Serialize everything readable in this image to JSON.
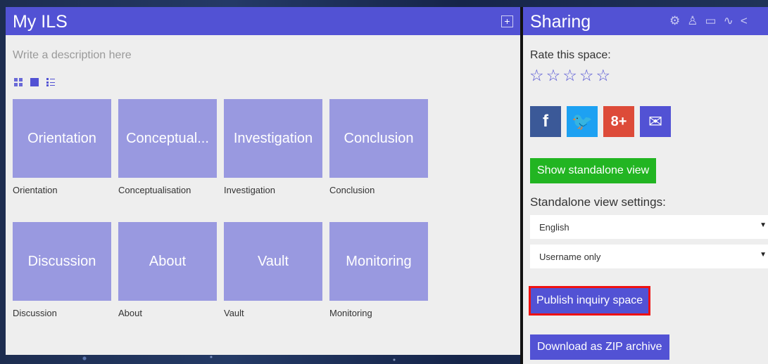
{
  "left_panel": {
    "title": "My ILS",
    "add_icon": "plus-square-icon",
    "description_placeholder": "Write a description here",
    "view_toggles": [
      "grid-view-icon",
      "tile-view-icon",
      "list-view-icon"
    ],
    "tiles": [
      {
        "label": "Orientation",
        "caption": "Orientation"
      },
      {
        "label": "Conceptual...",
        "caption": "Conceptualisation"
      },
      {
        "label": "Investigation",
        "caption": "Investigation"
      },
      {
        "label": "Conclusion",
        "caption": "Conclusion"
      },
      {
        "label": "Discussion",
        "caption": "Discussion"
      },
      {
        "label": "About",
        "caption": "About"
      },
      {
        "label": "Vault",
        "caption": "Vault"
      },
      {
        "label": "Monitoring",
        "caption": "Monitoring"
      }
    ]
  },
  "right_panel": {
    "title": "Sharing",
    "header_icons": [
      "settings-icon",
      "user-icon",
      "chat-icon",
      "activity-icon",
      "share-icon"
    ],
    "rate_label": "Rate this space:",
    "stars": [
      "☆",
      "☆",
      "☆",
      "☆",
      "☆"
    ],
    "socials": {
      "facebook": "f",
      "twitter": "🐦",
      "google_plus": "8+",
      "email": "✉"
    },
    "show_standalone_button": "Show standalone view",
    "standalone_settings_label": "Standalone view settings:",
    "language_select": "English",
    "user_display_select": "Username only",
    "publish_button": "Publish inquiry space",
    "download_button": "Download as ZIP archive"
  },
  "colors": {
    "header": "#5252d4",
    "tile": "#9999e0",
    "green": "#22b522",
    "highlight_border": "#ee1111"
  }
}
